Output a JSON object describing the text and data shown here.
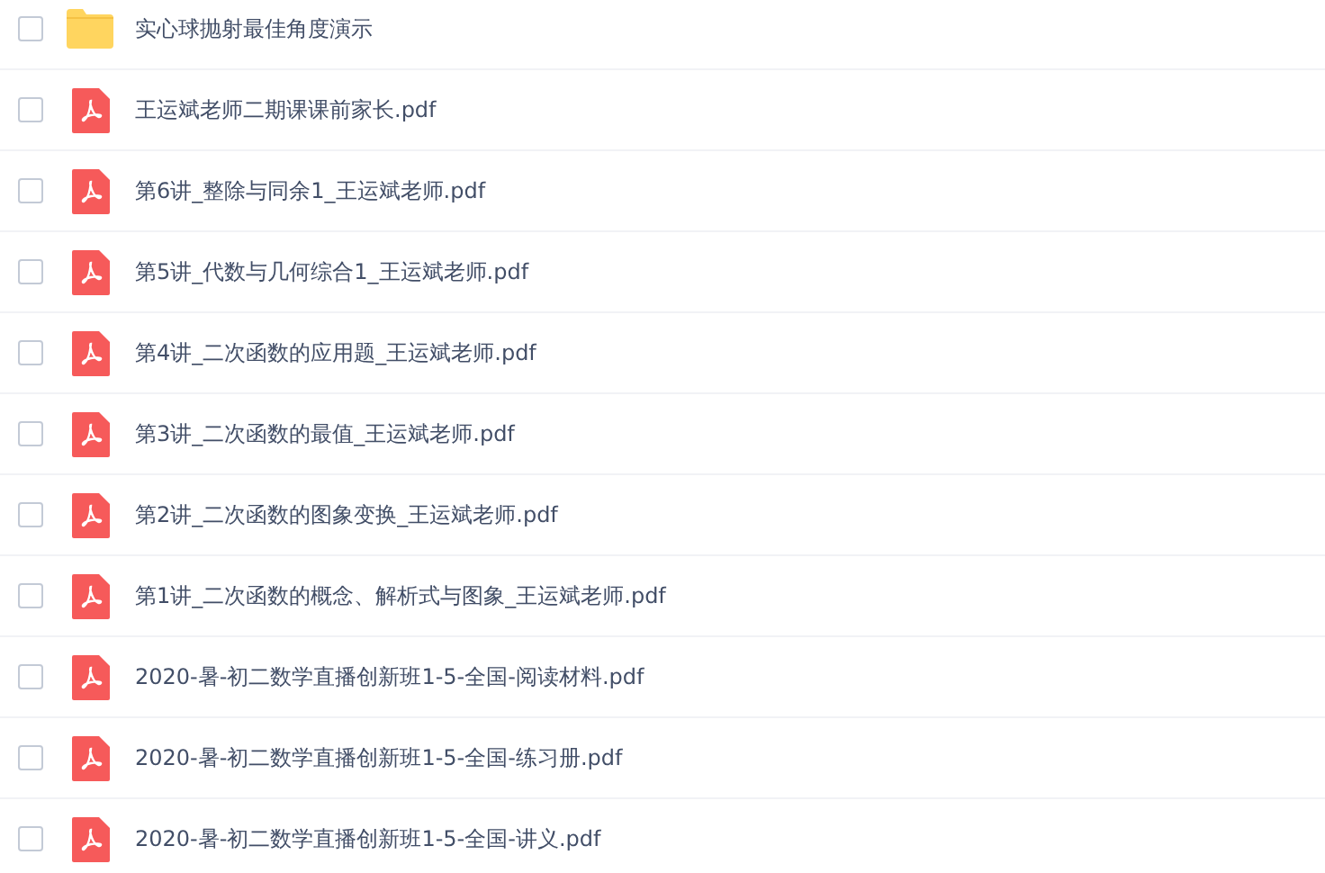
{
  "files": [
    {
      "kind": "folder",
      "name": "实心球抛射最佳角度演示",
      "checked": false
    },
    {
      "kind": "pdf",
      "name": "王运斌老师二期课课前家长.pdf",
      "checked": false
    },
    {
      "kind": "pdf",
      "name": "第6讲_整除与同余1_王运斌老师.pdf",
      "checked": false
    },
    {
      "kind": "pdf",
      "name": "第5讲_代数与几何综合1_王运斌老师.pdf",
      "checked": false
    },
    {
      "kind": "pdf",
      "name": "第4讲_二次函数的应用题_王运斌老师.pdf",
      "checked": false
    },
    {
      "kind": "pdf",
      "name": "第3讲_二次函数的最值_王运斌老师.pdf",
      "checked": false
    },
    {
      "kind": "pdf",
      "name": "第2讲_二次函数的图象变换_王运斌老师.pdf",
      "checked": false
    },
    {
      "kind": "pdf",
      "name": "第1讲_二次函数的概念、解析式与图象_王运斌老师.pdf",
      "checked": false
    },
    {
      "kind": "pdf",
      "name": "2020-暑-初二数学直播创新班1-5-全国-阅读材料.pdf",
      "checked": false
    },
    {
      "kind": "pdf",
      "name": "2020-暑-初二数学直播创新班1-5-全国-练习册.pdf",
      "checked": false
    },
    {
      "kind": "pdf",
      "name": "2020-暑-初二数学直播创新班1-5-全国-讲义.pdf",
      "checked": false
    }
  ]
}
